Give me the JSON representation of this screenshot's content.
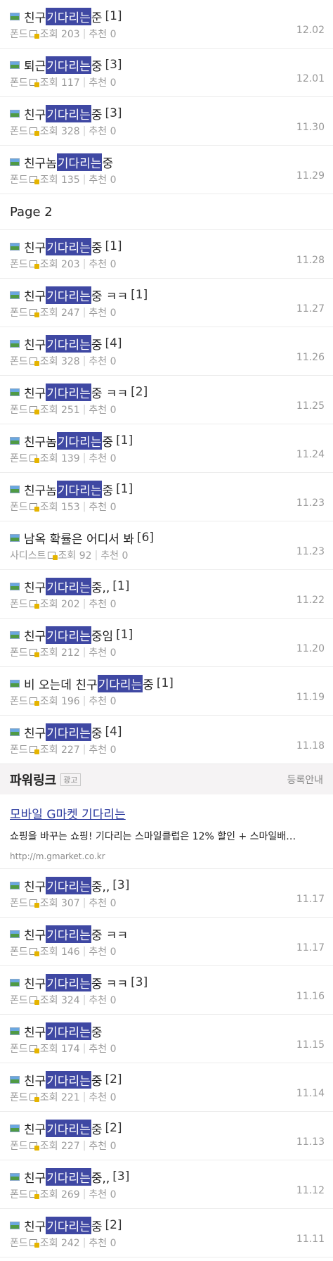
{
  "items_before": [
    {
      "pre": "친구 ",
      "hl": "기다리는",
      "post": "준",
      "comments": "[1]",
      "author": "폰드",
      "views": "조회 203",
      "likes": "추천 0",
      "date": "12.02"
    },
    {
      "pre": "퇴근 ",
      "hl": "기다리는",
      "post": "중",
      "comments": "[3]",
      "author": "폰드",
      "views": "조회 117",
      "likes": "추천 0",
      "date": "12.01"
    },
    {
      "pre": "친구 ",
      "hl": "기다리는",
      "post": "중",
      "comments": "[3]",
      "author": "폰드",
      "views": "조회 328",
      "likes": "추천 0",
      "date": "11.30"
    },
    {
      "pre": "친구놈 ",
      "hl": "기다리는",
      "post": "중",
      "comments": "",
      "author": "폰드",
      "views": "조회 135",
      "likes": "추천 0",
      "date": "11.29"
    }
  ],
  "page_label": "Page 2",
  "items_page2": [
    {
      "pre": "친구 ",
      "hl": "기다리는",
      "post": " 중",
      "comments": "[1]",
      "author": "폰드",
      "views": "조회 203",
      "likes": "추천 0",
      "date": "11.28"
    },
    {
      "pre": "친구 ",
      "hl": "기다리는",
      "post": "중 ㅋㅋ",
      "comments": "[1]",
      "author": "폰드",
      "views": "조회 247",
      "likes": "추천 0",
      "date": "11.27"
    },
    {
      "pre": "친구 ",
      "hl": "기다리는",
      "post": "중",
      "comments": "[4]",
      "author": "폰드",
      "views": "조회 328",
      "likes": "추천 0",
      "date": "11.26"
    },
    {
      "pre": "친구 ",
      "hl": "기다리는",
      "post": "중 ㅋㅋ",
      "comments": "[2]",
      "author": "폰드",
      "views": "조회 251",
      "likes": "추천 0",
      "date": "11.25"
    },
    {
      "pre": "친구놈 ",
      "hl": "기다리는",
      "post": "중",
      "comments": "[1]",
      "author": "폰드",
      "views": "조회 139",
      "likes": "추천 0",
      "date": "11.24"
    },
    {
      "pre": "친구놈 ",
      "hl": "기다리는",
      "post": "중",
      "comments": "[1]",
      "author": "폰드",
      "views": "조회 153",
      "likes": "추천 0",
      "date": "11.23"
    },
    {
      "pre": "남옥 확률은 어디서 봐",
      "hl": "",
      "post": "",
      "comments": "[6]",
      "author": "사디스트",
      "views": "조회 92",
      "likes": "추천 0",
      "date": "11.23"
    },
    {
      "pre": "친구 ",
      "hl": "기다리는",
      "post": "중,,",
      "comments": "[1]",
      "author": "폰드",
      "views": "조회 202",
      "likes": "추천 0",
      "date": "11.22"
    },
    {
      "pre": "친구 ",
      "hl": "기다리는",
      "post": "중임",
      "comments": "[1]",
      "author": "폰드",
      "views": "조회 212",
      "likes": "추천 0",
      "date": "11.20"
    },
    {
      "pre": "비 오는데 친구 ",
      "hl": "기다리는",
      "post": " 중",
      "comments": "[1]",
      "author": "폰드",
      "views": "조회 196",
      "likes": "추천 0",
      "date": "11.19"
    },
    {
      "pre": "친구",
      "hl": "기다리는",
      "post": "중",
      "comments": "[4]",
      "author": "폰드",
      "views": "조회 227",
      "likes": "추천 0",
      "date": "11.18"
    }
  ],
  "powerlink": {
    "title": "파워링크",
    "badge": "광고",
    "register": "등록안내",
    "ad_title": "모바일 G마켓 기다리는",
    "ad_desc": "쇼핑을 바꾸는 쇼핑! 기다리는 스마일클럽은 12% 할인 + 스마일배…",
    "ad_url": "http://m.gmarket.co.kr"
  },
  "items_after": [
    {
      "pre": "친구 ",
      "hl": "기다리는",
      "post": "중,,",
      "comments": "[3]",
      "author": "폰드",
      "views": "조회 307",
      "likes": "추천 0",
      "date": "11.17"
    },
    {
      "pre": "친구 ",
      "hl": "기다리는",
      "post": " 중 ㅋㅋ",
      "comments": "",
      "author": "폰드",
      "views": "조회 146",
      "likes": "추천 0",
      "date": "11.17"
    },
    {
      "pre": "친구 ",
      "hl": "기다리는",
      "post": "중 ㅋㅋ",
      "comments": "[3]",
      "author": "폰드",
      "views": "조회 324",
      "likes": "추천 0",
      "date": "11.16"
    },
    {
      "pre": "친구 ",
      "hl": "기다리는",
      "post": "중",
      "comments": "",
      "author": "폰드",
      "views": "조회 174",
      "likes": "추천 0",
      "date": "11.15"
    },
    {
      "pre": "친구 ",
      "hl": "기다리는",
      "post": "중",
      "comments": "[2]",
      "author": "폰드",
      "views": "조회 221",
      "likes": "추천 0",
      "date": "11.14"
    },
    {
      "pre": "친구 ",
      "hl": "기다리는",
      "post": "중",
      "comments": "[2]",
      "author": "폰드",
      "views": "조회 227",
      "likes": "추천 0",
      "date": "11.13"
    },
    {
      "pre": "친구 ",
      "hl": "기다리는",
      "post": "중,,",
      "comments": "[3]",
      "author": "폰드",
      "views": "조회 269",
      "likes": "추천 0",
      "date": "11.12"
    },
    {
      "pre": "친구 ",
      "hl": "기다리는",
      "post": "중",
      "comments": "[2]",
      "author": "폰드",
      "views": "조회 242",
      "likes": "추천 0",
      "date": "11.11"
    }
  ]
}
